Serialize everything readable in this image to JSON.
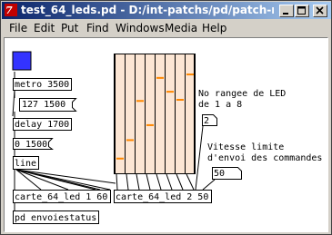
{
  "window": {
    "title": "test_64_leds.pd",
    "path": "D:/int-patchs/pd/patch-mate..."
  },
  "menu": [
    "File",
    "Edit",
    "Put",
    "Find",
    "Windows",
    "Media",
    "Help"
  ],
  "patch": {
    "bang_color": "#3333ff",
    "slider_bg": "#fce6d4",
    "slider_knob_color": "#ff8800",
    "slider_values": [
      0.12,
      0.28,
      0.62,
      0.41,
      0.82,
      0.7,
      0.63,
      0.85
    ],
    "objects": {
      "metro": "metro 3500",
      "msg_127": "127 1500",
      "delay": "delay 1700",
      "msg_0": "0 1500",
      "line": "line",
      "carte1": "carte_64_led 1 60",
      "carte2": "carte_64_led 2 50",
      "envoie": "pd envoiestatus"
    },
    "comments": {
      "rangee_1": "No rangee de LED",
      "rangee_2": "de 1 a 8",
      "vitesse_1": "Vitesse limite",
      "vitesse_2": "d'envoi des commandes"
    },
    "numbers": {
      "row_number": "2",
      "speed_number": "50"
    }
  }
}
